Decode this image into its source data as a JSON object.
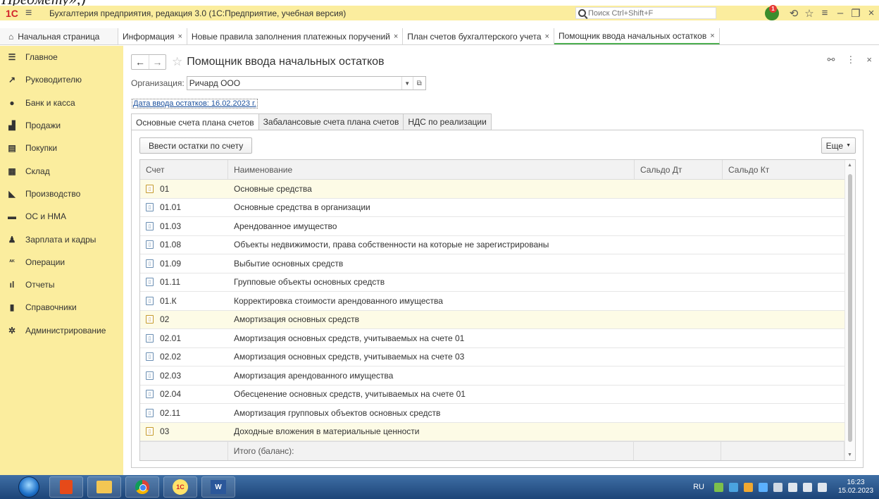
{
  "window": {
    "logo": "1С",
    "title": "Бухгалтерия предприятия, редакция 3.0  (1С:Предприятие, учебная версия)",
    "search_placeholder": "Поиск Ctrl+Shift+F",
    "notification_count": "1"
  },
  "page_tabs": {
    "home": "Начальная страница",
    "open": [
      {
        "label": "Информация",
        "active": false
      },
      {
        "label": "Новые правила заполнения платежных поручений",
        "active": false
      },
      {
        "label": "План счетов бухгалтерского учета",
        "active": false
      },
      {
        "label": "Помощник ввода начальных остатков",
        "active": true
      }
    ]
  },
  "sidebar": {
    "items": [
      {
        "label": "Главное",
        "icon": "menu-icon"
      },
      {
        "label": "Руководителю",
        "icon": "trend-icon"
      },
      {
        "label": "Банк и касса",
        "icon": "coin-icon"
      },
      {
        "label": "Продажи",
        "icon": "bag-icon"
      },
      {
        "label": "Покупки",
        "icon": "cart-icon"
      },
      {
        "label": "Склад",
        "icon": "warehouse-icon"
      },
      {
        "label": "Производство",
        "icon": "factory-icon"
      },
      {
        "label": "ОС и НМА",
        "icon": "truck-icon"
      },
      {
        "label": "Зарплата и кадры",
        "icon": "person-icon"
      },
      {
        "label": "Операции",
        "icon": "dt-kt-icon"
      },
      {
        "label": "Отчеты",
        "icon": "bar-chart-icon"
      },
      {
        "label": "Справочники",
        "icon": "book-icon"
      },
      {
        "label": "Администрирование",
        "icon": "gear-icon"
      }
    ]
  },
  "form": {
    "title": "Помощник ввода начальных остатков",
    "org_label": "Организация:",
    "org_value": "Ричард ООО",
    "date_link": "Дата ввода остатков: 16.02.2023 г.",
    "tabs": [
      "Основные счета плана счетов",
      "Забалансовые счета плана счетов",
      "НДС по реализации"
    ],
    "enter_button": "Ввести остатки по счету",
    "more_button": "Еще"
  },
  "table": {
    "columns": [
      "Счет",
      "Наименование",
      "Сальдо Дт",
      "Сальдо Кт"
    ],
    "rows": [
      {
        "account": "01",
        "name": "Основные средства",
        "group": true
      },
      {
        "account": "01.01",
        "name": "Основные средства в организации",
        "group": false
      },
      {
        "account": "01.03",
        "name": "Арендованное имущество",
        "group": false
      },
      {
        "account": "01.08",
        "name": "Объекты недвижимости, права собственности на которые не зарегистрированы",
        "group": false
      },
      {
        "account": "01.09",
        "name": "Выбытие основных средств",
        "group": false
      },
      {
        "account": "01.11",
        "name": "Групповые объекты основных средств",
        "group": false
      },
      {
        "account": "01.К",
        "name": "Корректировка стоимости арендованного имущества",
        "group": false
      },
      {
        "account": "02",
        "name": "Амортизация основных средств",
        "group": true
      },
      {
        "account": "02.01",
        "name": "Амортизация основных средств, учитываемых на счете 01",
        "group": false
      },
      {
        "account": "02.02",
        "name": "Амортизация основных средств, учитываемых на счете 03",
        "group": false
      },
      {
        "account": "02.03",
        "name": "Амортизация арендованного имущества",
        "group": false
      },
      {
        "account": "02.04",
        "name": "Обесценение основных средств, учитываемых на счете 01",
        "group": false
      },
      {
        "account": "02.11",
        "name": "Амортизация групповых объектов основных средств",
        "group": false
      },
      {
        "account": "03",
        "name": "Доходные вложения в материальные ценности",
        "group": true
      }
    ],
    "total_label": "Итого (баланс):"
  },
  "taskbar": {
    "lang": "RU",
    "time": "16:23",
    "date": "15.02.2023",
    "word_label": "W"
  }
}
